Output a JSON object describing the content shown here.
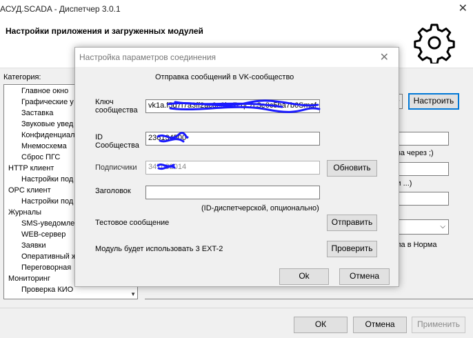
{
  "window": {
    "title": "АСУД.SCADA - Диспетчер 3.0.1",
    "header_title": "Настройки приложения и загруженных модулей"
  },
  "category_label": "Категория:",
  "tree": [
    {
      "label": "Главное окно",
      "level": 1
    },
    {
      "label": "Графические у",
      "level": 1
    },
    {
      "label": "Заставка",
      "level": 1
    },
    {
      "label": "Звуковые увед",
      "level": 1
    },
    {
      "label": "Конфиденциал",
      "level": 1
    },
    {
      "label": "Мнемосхема",
      "level": 1
    },
    {
      "label": "Сброс ПГС",
      "level": 1
    },
    {
      "label": "HTTP клиент",
      "level": 0
    },
    {
      "label": "Настройки под",
      "level": 1
    },
    {
      "label": "OPC клиент",
      "level": 0
    },
    {
      "label": "Настройки под",
      "level": 1
    },
    {
      "label": "Журналы",
      "level": 0
    },
    {
      "label": "SMS-уведомлен",
      "level": 1
    },
    {
      "label": "WEB-сервер",
      "level": 1
    },
    {
      "label": "Заявки",
      "level": 1
    },
    {
      "label": "Оперативный ж",
      "level": 1
    },
    {
      "label": "Переговорная",
      "level": 1
    },
    {
      "label": "Мониторинг",
      "level": 0
    },
    {
      "label": "Проверка КИО",
      "level": 1
    }
  ],
  "right_panel": {
    "configure_button": "Настроить",
    "text_1": "ова через ;)",
    "text_2": "ли ...)",
    "text_3": "ала в Норма"
  },
  "footer": {
    "ok": "ОК",
    "cancel": "Отмена",
    "apply": "Применить"
  },
  "dialog": {
    "title": "Настройка параметров соединения",
    "heading": "Отправка сообщений в VK-сообщество",
    "key_label_1": "Ключ",
    "key_label_2": "сообщества",
    "key_value": "vk1a.f5d7f7a3ff2ac0e9bc7cqc7c3e0c5ba7b6Smaf",
    "id_label_1": "ID",
    "id_label_2": "Сообщества",
    "id_value": "236134500",
    "subscribers_label": "Подписчики",
    "subscribers_value": "347082014",
    "refresh_button": "Обновить",
    "header_label": "Заголовок",
    "header_value": "",
    "header_hint": "(ID-диспетчерской, опционально)",
    "test_label": "Тестовое сообщение",
    "send_button": "Отправить",
    "module_text": "Модуль будет использовать 3  EXT-2",
    "check_button": "Проверить",
    "ok_button": "Ok",
    "cancel_button": "Отмена"
  }
}
